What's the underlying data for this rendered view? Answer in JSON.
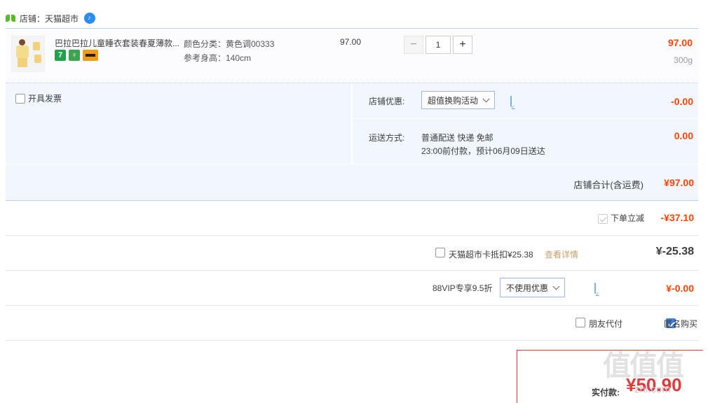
{
  "store": {
    "label": "店铺：天猫超市"
  },
  "item": {
    "title": "巴拉巴拉儿童睡衣套装春夏薄款...",
    "sku_color": "颜色分类：黄色调00333",
    "sku_size": "参考身高：140cm",
    "unit_price": "97.00",
    "quantity": "1",
    "qty_minus": "−",
    "qty_plus": "+",
    "total": "97.00",
    "weight": "300g"
  },
  "invoice": {
    "label": "开具发票"
  },
  "store_discount": {
    "label": "店铺优惠:",
    "selected": "超值换购活动",
    "amount": "-0.00"
  },
  "shipping": {
    "label": "运送方式:",
    "method": "普通配送 快递 免邮",
    "eta": "23:00前付款，预计06月09日送达",
    "amount": "0.00"
  },
  "store_total": {
    "label": "店铺合计(含运费)",
    "amount": "¥97.00"
  },
  "instant_discount": {
    "label": "下单立减",
    "amount": "-¥37.10"
  },
  "tmall_card": {
    "label": "天猫超市卡抵扣¥25.38",
    "link": "查看详情",
    "amount": "¥-25.38"
  },
  "vip": {
    "label": "88VIP专享9.5折",
    "selected": "不使用优惠",
    "amount": "¥-0.00"
  },
  "friend_pay": {
    "label": "朋友代付"
  },
  "anonymous": {
    "label": "匿名购买"
  },
  "final": {
    "label": "实付款:",
    "amount": "¥50.90"
  },
  "colors": {
    "accent": "#f40",
    "border": "#b2d1ff",
    "panel": "#f1f6ff"
  }
}
